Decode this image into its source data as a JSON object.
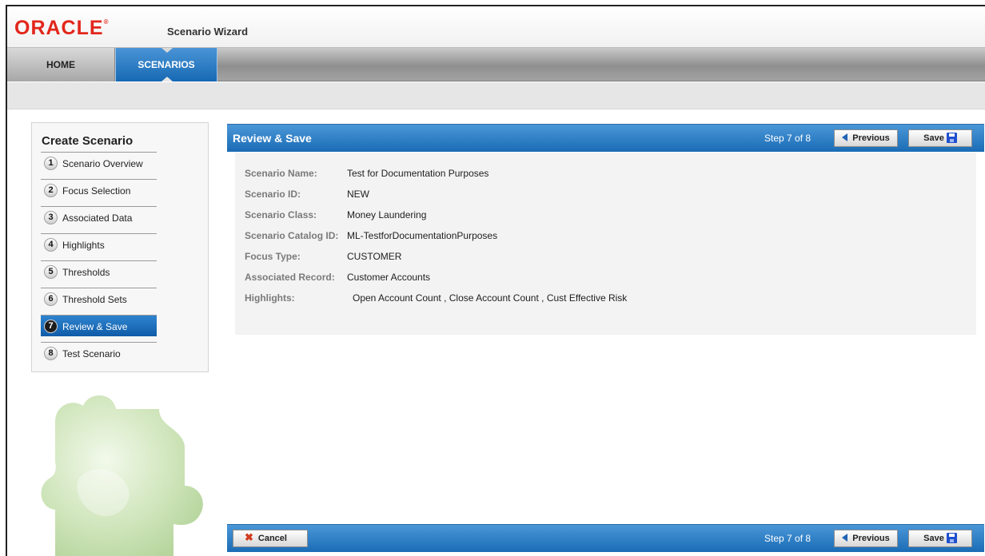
{
  "header": {
    "logo_text": "ORACLE",
    "logo_mark": "®",
    "app_title": "Scenario Wizard"
  },
  "nav": {
    "tabs": [
      {
        "label": "HOME",
        "active": false
      },
      {
        "label": "SCENARIOS",
        "active": true
      }
    ]
  },
  "sidebar": {
    "title": "Create Scenario",
    "steps": [
      {
        "num": "1",
        "label": "Scenario Overview"
      },
      {
        "num": "2",
        "label": "Focus Selection"
      },
      {
        "num": "3",
        "label": "Associated Data"
      },
      {
        "num": "4",
        "label": "Highlights"
      },
      {
        "num": "5",
        "label": "Thresholds"
      },
      {
        "num": "6",
        "label": "Threshold Sets"
      },
      {
        "num": "7",
        "label": "Review & Save",
        "active": true
      },
      {
        "num": "8",
        "label": "Test Scenario"
      }
    ]
  },
  "panel": {
    "title": "Review & Save",
    "step_indicator": "Step 7 of 8",
    "previous_label": "Previous",
    "save_label": "Save",
    "cancel_label": "Cancel",
    "fields": [
      {
        "label": "Scenario Name:",
        "value": "Test for Documentation Purposes"
      },
      {
        "label": "Scenario ID:",
        "value": "NEW"
      },
      {
        "label": "Scenario Class:",
        "value": "Money Laundering"
      },
      {
        "label": "Scenario Catalog ID:",
        "value": "ML-TestforDocumentationPurposes"
      },
      {
        "label": "Focus Type:",
        "value": "CUSTOMER"
      },
      {
        "label": "Associated Record:",
        "value": "Customer Accounts"
      },
      {
        "label": "Highlights:",
        "value": "Open Account Count , Close Account Count , Cust Effective Risk"
      }
    ]
  },
  "colors": {
    "brand_red": "#e2261b",
    "accent_blue": "#1a6cb6"
  }
}
